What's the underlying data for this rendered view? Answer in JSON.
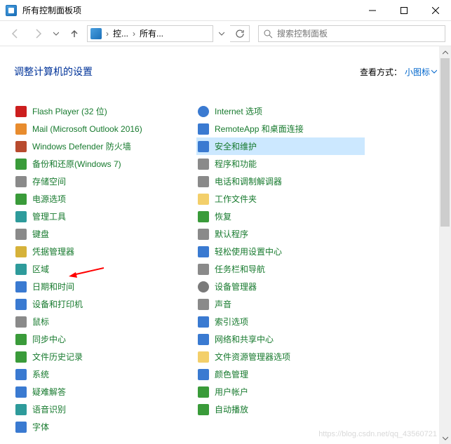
{
  "titlebar": {
    "title": "所有控制面板项"
  },
  "nav": {
    "breadcrumb": {
      "seg1": "控...",
      "seg2": "所有..."
    },
    "search_placeholder": "搜索控制面板"
  },
  "header": {
    "heading": "调整计算机的设置",
    "viewby_label": "查看方式：",
    "viewby_value": "小图标"
  },
  "col1": [
    {
      "label": "Flash Player (32 位)",
      "icon": "ic-red",
      "name": "flash-player"
    },
    {
      "label": "Mail (Microsoft Outlook 2016)",
      "icon": "ic-orange",
      "name": "mail-outlook"
    },
    {
      "label": "Windows Defender 防火墙",
      "icon": "ic-brick",
      "name": "defender-firewall"
    },
    {
      "label": "备份和还原(Windows 7)",
      "icon": "ic-green",
      "name": "backup-restore"
    },
    {
      "label": "存储空间",
      "icon": "ic-grey",
      "name": "storage-spaces"
    },
    {
      "label": "电源选项",
      "icon": "ic-green",
      "name": "power-options"
    },
    {
      "label": "管理工具",
      "icon": "ic-teal",
      "name": "admin-tools"
    },
    {
      "label": "键盘",
      "icon": "ic-grey",
      "name": "keyboard"
    },
    {
      "label": "凭据管理器",
      "icon": "ic-yellow",
      "name": "credential-manager"
    },
    {
      "label": "区域",
      "icon": "ic-teal",
      "name": "region"
    },
    {
      "label": "日期和时间",
      "icon": "ic-blue",
      "name": "date-time"
    },
    {
      "label": "设备和打印机",
      "icon": "ic-blue",
      "name": "devices-printers"
    },
    {
      "label": "鼠标",
      "icon": "ic-grey",
      "name": "mouse"
    },
    {
      "label": "同步中心",
      "icon": "ic-green",
      "name": "sync-center"
    },
    {
      "label": "文件历史记录",
      "icon": "ic-green",
      "name": "file-history"
    },
    {
      "label": "系统",
      "icon": "ic-blue",
      "name": "system"
    },
    {
      "label": "疑难解答",
      "icon": "ic-blue",
      "name": "troubleshooting"
    },
    {
      "label": "语音识别",
      "icon": "ic-teal",
      "name": "speech"
    },
    {
      "label": "字体",
      "icon": "ic-blue",
      "name": "fonts"
    }
  ],
  "col2": [
    {
      "label": "Internet 选项",
      "icon": "ic-globe",
      "name": "internet-options"
    },
    {
      "label": "RemoteApp 和桌面连接",
      "icon": "ic-blue",
      "name": "remoteapp"
    },
    {
      "label": "安全和维护",
      "icon": "ic-flag",
      "name": "security-maintenance",
      "selected": true
    },
    {
      "label": "程序和功能",
      "icon": "ic-grey",
      "name": "programs-features"
    },
    {
      "label": "电话和调制解调器",
      "icon": "ic-grey",
      "name": "phone-modem"
    },
    {
      "label": "工作文件夹",
      "icon": "ic-folder",
      "name": "work-folders"
    },
    {
      "label": "恢复",
      "icon": "ic-green",
      "name": "recovery"
    },
    {
      "label": "默认程序",
      "icon": "ic-grey",
      "name": "default-programs"
    },
    {
      "label": "轻松使用设置中心",
      "icon": "ic-blue",
      "name": "ease-of-access"
    },
    {
      "label": "任务栏和导航",
      "icon": "ic-grey",
      "name": "taskbar-nav"
    },
    {
      "label": "设备管理器",
      "icon": "ic-gear",
      "name": "device-manager"
    },
    {
      "label": "声音",
      "icon": "ic-grey",
      "name": "sound"
    },
    {
      "label": "索引选项",
      "icon": "ic-blue",
      "name": "indexing"
    },
    {
      "label": "网络和共享中心",
      "icon": "ic-blue",
      "name": "network-sharing"
    },
    {
      "label": "文件资源管理器选项",
      "icon": "ic-folder",
      "name": "explorer-options"
    },
    {
      "label": "颜色管理",
      "icon": "ic-blue",
      "name": "color-management"
    },
    {
      "label": "用户帐户",
      "icon": "ic-green",
      "name": "user-accounts"
    },
    {
      "label": "自动播放",
      "icon": "ic-green",
      "name": "autoplay"
    }
  ],
  "watermark": "https://blog.csdn.net/qq_43560721"
}
